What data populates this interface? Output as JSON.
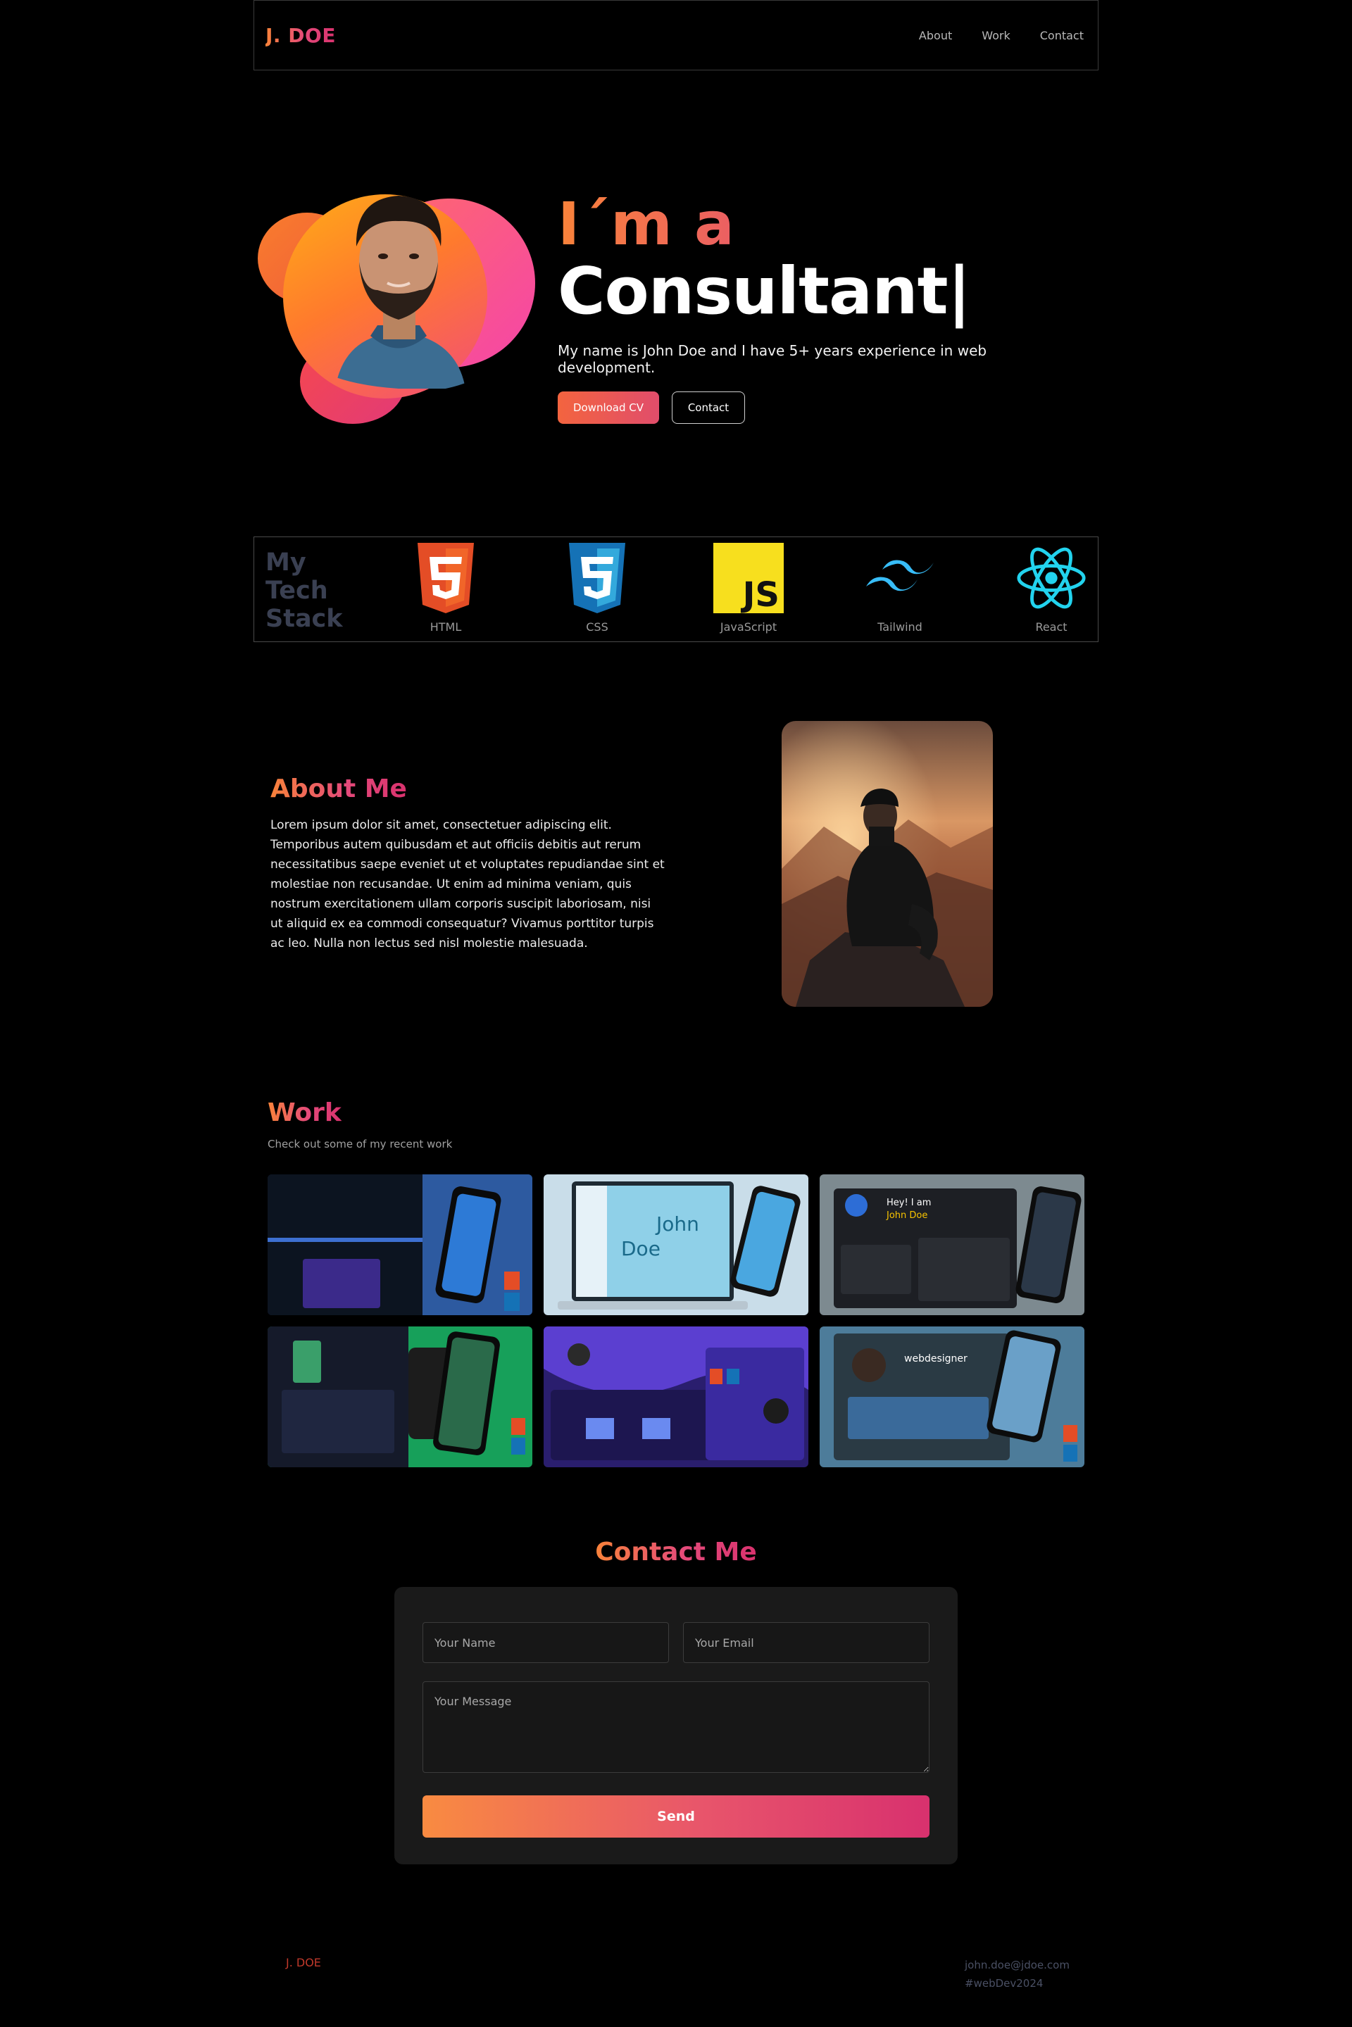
{
  "nav": {
    "logo": "J. DOE",
    "links": [
      "About",
      "Work",
      "Contact"
    ]
  },
  "hero": {
    "line1": "I´m a",
    "line2": "Consultant|",
    "subtitle": "My name is John Doe and I have 5+ years experience in web development.",
    "download_label": "Download CV",
    "contact_label": "Contact"
  },
  "tech": {
    "title_lines": [
      "My",
      "Tech",
      "Stack"
    ],
    "items": [
      {
        "label": "HTML",
        "icon": "html5-icon"
      },
      {
        "label": "CSS",
        "icon": "css3-icon"
      },
      {
        "label": "JavaScript",
        "icon": "javascript-icon"
      },
      {
        "label": "Tailwind",
        "icon": "tailwind-icon"
      },
      {
        "label": "React",
        "icon": "react-icon"
      }
    ]
  },
  "about": {
    "title": "About Me",
    "body": "Lorem ipsum dolor sit amet, consectetuer adipiscing elit. Temporibus autem quibusdam et aut officiis debitis aut rerum necessitatibus saepe eveniet ut et voluptates repudiandae sint et molestiae non recusandae. Ut enim ad minima veniam, quis nostrum exercitationem ullam corporis suscipit laboriosam, nisi ut aliquid ex ea commodi consequatur? Vivamus porttitor turpis ac leo. Nulla non lectus sed nisl molestie malesuada."
  },
  "work": {
    "title": "Work",
    "subtitle": "Check out some of my recent work"
  },
  "contact": {
    "title": "Contact Me",
    "name_placeholder": "Your Name",
    "email_placeholder": "Your Email",
    "message_placeholder": "Your Message",
    "send_label": "Send"
  },
  "footer": {
    "logo": "J. DOE",
    "email": "john.doe@jdoe.com",
    "tag": "#webDev2024"
  },
  "colors": {
    "accent_orange": "#f9833a",
    "accent_pink": "#d9326e",
    "background": "#000000"
  }
}
